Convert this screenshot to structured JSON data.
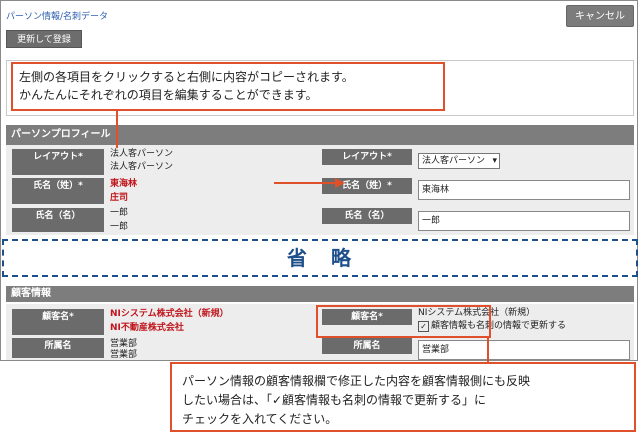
{
  "breadcrumb": "パーソン情報/名刺データ",
  "buttons": {
    "cancel": "キャンセル",
    "update": "更新して登録"
  },
  "callout_top": {
    "line1": "左側の各項目をクリックすると右側に内容がコピーされます。",
    "line2": "かんたんにそれぞれの項目を編集することができます。"
  },
  "person_profile": {
    "title": "パーソンプロフィール",
    "layout_label": "レイアウト*",
    "layout_values": [
      "法人客パーソン",
      "法人客パーソン"
    ],
    "layout_select": "法人客パーソン",
    "lastname_label": "氏名（姓）*",
    "lastname_values": [
      "東海林",
      "庄司"
    ],
    "lastname_input": "東海林",
    "firstname_label": "氏名（名）",
    "firstname_values": [
      "一郎",
      "一郎"
    ],
    "firstname_input": "一郎"
  },
  "omitted": "省　略",
  "customer_info": {
    "title": "顧客情報",
    "customer_label": "顧客名*",
    "customer_values": [
      "NIシステム株式会社（新規）",
      "NI不動産株式会社"
    ],
    "customer_right": "NIシステム株式会社（新規）",
    "checkbox_label": "顧客情報も名刺の情報で更新する",
    "dept_label": "所属名",
    "dept_values": [
      "営業部",
      "営業部"
    ],
    "dept_input": "営業部"
  },
  "callout_bottom": {
    "line1": "パーソン情報の顧客情報欄で修正した内容を顧客情報側にも反映",
    "line2": "したい場合は、「✓顧客情報も名刺の情報で更新する」に",
    "line3": "チェックを入れてください。"
  },
  "colors": {
    "accent": "#e0502a",
    "header": "#7d7d7d",
    "label": "#6b6b6b",
    "omit": "#1d4f8a",
    "required_red": "#c0161c"
  }
}
